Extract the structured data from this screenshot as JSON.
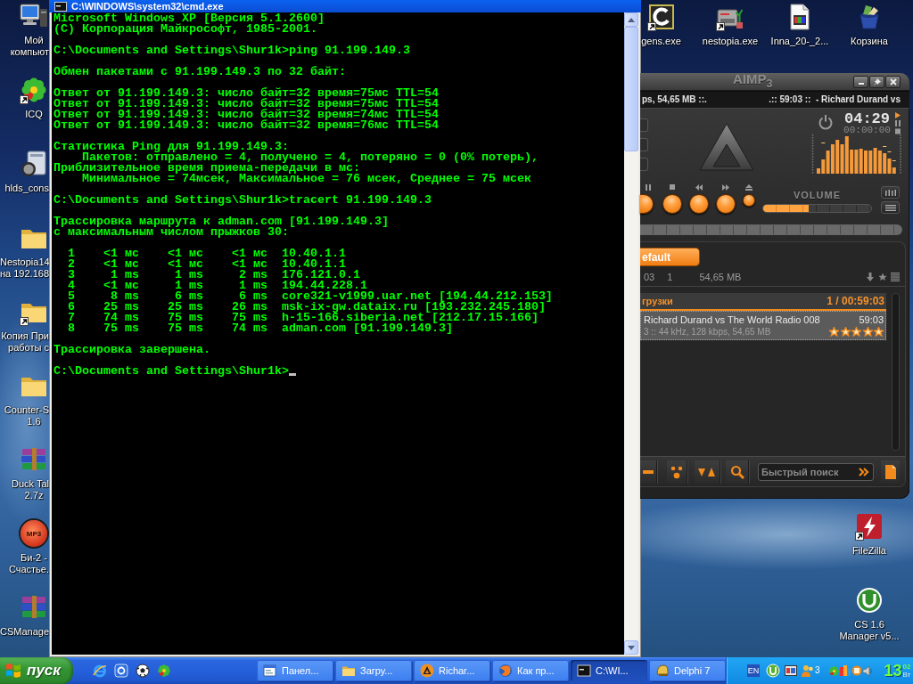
{
  "desktop_left_icons": [
    {
      "kind": "computer",
      "shortcut": false,
      "lines": [
        "Мой",
        "компьют"
      ]
    },
    {
      "kind": "icq",
      "shortcut": true,
      "lines": [
        "ICQ"
      ]
    },
    {
      "kind": "server",
      "shortcut": false,
      "lines": [
        "hlds_cons"
      ]
    },
    {
      "kind": "folder",
      "shortcut": false,
      "lines": [
        "Nestopia14",
        "на 192.168"
      ]
    },
    {
      "kind": "folder",
      "shortcut": true,
      "lines": [
        "Копия При",
        "работы с"
      ]
    },
    {
      "kind": "folder",
      "shortcut": false,
      "lines": [
        "Counter-S",
        "1.6"
      ]
    },
    {
      "kind": "archive",
      "shortcut": false,
      "lines": [
        "Duck Tal",
        "2.7z"
      ]
    },
    {
      "kind": "mp3",
      "badge": "MP3",
      "shortcut": false,
      "lines": [
        "Би-2 -",
        "Счастье."
      ]
    },
    {
      "kind": "archive",
      "shortcut": false,
      "lines": [
        "CSManage"
      ]
    }
  ],
  "desktop_top_icons": [
    {
      "kind": "gens",
      "shortcut": true,
      "lines": [
        "gens.exe"
      ]
    },
    {
      "kind": "console",
      "shortcut": true,
      "lines": [
        "nestopia.exe"
      ]
    },
    {
      "kind": "video",
      "shortcut": false,
      "lines": [
        "Inna_20-_2..."
      ]
    },
    {
      "kind": "recycle",
      "shortcut": false,
      "lines": [
        "Корзина"
      ]
    }
  ],
  "desktop_right_icons": [
    {
      "kind": "filezilla",
      "shortcut": true,
      "lines": [
        "FileZilla"
      ]
    },
    {
      "kind": "manager",
      "shortcut": false,
      "lines": [
        "CS 1.6",
        "Manager v5..."
      ]
    }
  ],
  "console_window": {
    "title": "C:\\WINDOWS\\system32\\cmd.exe",
    "blocks": [
      [
        "Microsoft Windows XP [Версия 5.1.2600]",
        "(C) Корпорация Майкрософт, 1985-2001."
      ],
      [
        "C:\\Documents and Settings\\Shur1k>ping 91.199.149.3"
      ],
      [
        "Обмен пакетами с 91.199.149.3 по 32 байт:"
      ],
      [
        "Ответ от 91.199.149.3: число байт=32 время=75мс TTL=54",
        "Ответ от 91.199.149.3: число байт=32 время=75мс TTL=54",
        "Ответ от 91.199.149.3: число байт=32 время=74мс TTL=54",
        "Ответ от 91.199.149.3: число байт=32 время=76мс TTL=54"
      ],
      [
        "Статистика Ping для 91.199.149.3:",
        "    Пакетов: отправлено = 4, получено = 4, потеряно = 0 (0% потерь),",
        "Приблизительное время приема-передачи в мс:",
        "    Минимальное = 74мсек, Максимальное = 76 мсек, Среднее = 75 мсек"
      ],
      [
        "C:\\Documents and Settings\\Shur1k>tracert 91.199.149.3"
      ],
      [
        "Трассировка маршрута к adman.com [91.199.149.3]",
        "с максимальным числом прыжков 30:"
      ],
      [
        "  1    <1 мс    <1 мс    <1 мс  10.40.1.1",
        "  2    <1 мс    <1 мс    <1 мс  10.40.1.1",
        "  3     1 ms     1 ms     2 ms  176.121.0.1",
        "  4    <1 мс     1 ms     1 ms  194.44.228.1",
        "  5     8 ms     6 ms     6 ms  core321-v1999.uar.net [194.44.212.153]",
        "  6    25 ms    25 ms    26 ms  msk-ix-gw.dataix.ru [193.232.245.180]",
        "  7    74 ms    75 ms    75 ms  h-15-166.siberia.net [212.17.15.166]",
        "  8    75 ms    75 ms    74 ms  adman.com [91.199.149.3]"
      ],
      [
        "Трассировка завершена."
      ]
    ],
    "prompt": "C:\\Documents and Settings\\Shur1k>"
  },
  "player": {
    "logo": "AIMP$_{3}$",
    "ticker_left": "ps, 54,65 MB ::.",
    "ticker_right": ".:: 59:03 ::  - Richard Durand vs",
    "time": "04:29",
    "elapsed": "00:00:00",
    "volume_label": "VOLUME",
    "volume": {
      "level": 0.42
    },
    "playlist": {
      "tabs": [
        {
          "label": "efault",
          "selected": true
        }
      ],
      "stats": [
        "03",
        "1",
        "54,65 MB"
      ],
      "group": {
        "title": "грузки",
        "summary": "1 / 00:59:03"
      },
      "tracks": [
        {
          "title": "Richard Durand vs The World Radio 008",
          "duration": "59:03",
          "details": "3 :: 44 kHz, 128 kbps, 54,65 MB",
          "stars": 5,
          "selected": true
        }
      ],
      "search": {
        "placeholder": "Быстрый поиск"
      }
    }
  },
  "taskbar": {
    "start_label": "пуск",
    "tasks": [
      {
        "kind": "panel",
        "label": "Панел...",
        "selected": false
      },
      {
        "kind": "folder",
        "label": "Загру...",
        "selected": false
      },
      {
        "kind": "player",
        "label": "Richar...",
        "selected": false
      },
      {
        "kind": "browser",
        "label": "Как пр...",
        "selected": false
      },
      {
        "kind": "console",
        "label": "C:\\WI...",
        "selected": true
      },
      {
        "kind": "ide",
        "label": "Delphi 7",
        "selected": false
      }
    ],
    "tray": {
      "language": "EN",
      "count": "3"
    },
    "clock": {
      "hours": "13",
      "minutes": "02",
      "day": "Вт"
    }
  }
}
